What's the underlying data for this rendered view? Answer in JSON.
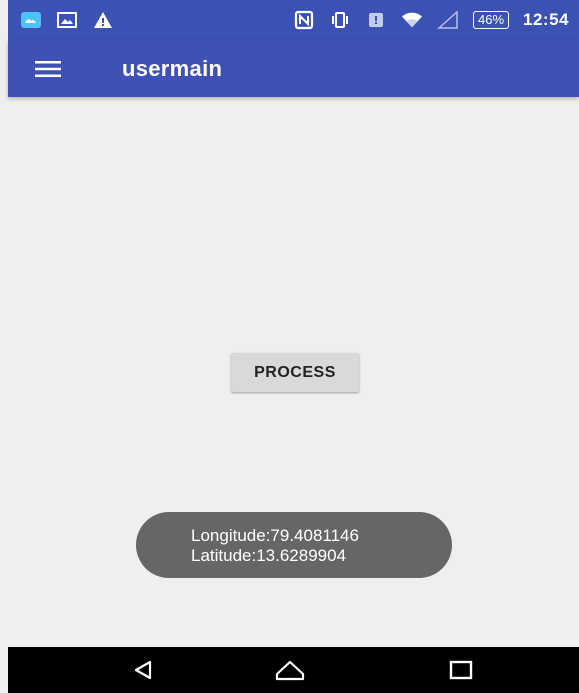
{
  "status_bar": {
    "battery": "46%",
    "time": "12:54",
    "icons_left": [
      "cloud-app-icon",
      "image-icon",
      "warning-icon"
    ],
    "icons_right": [
      "nfc-icon",
      "vibrate-icon",
      "alert-icon",
      "wifi-icon",
      "signal-icon"
    ]
  },
  "app_bar": {
    "title": "usermain",
    "menu_icon": "hamburger-menu-icon",
    "color": "#3f51b5"
  },
  "main": {
    "process_label": "PROCESS"
  },
  "toast": {
    "line1": "Longitude:79.4081146",
    "line2": "Latitude:13.6289904"
  },
  "nav_bar": {
    "icons": [
      "back-icon",
      "home-icon",
      "recents-icon"
    ]
  }
}
